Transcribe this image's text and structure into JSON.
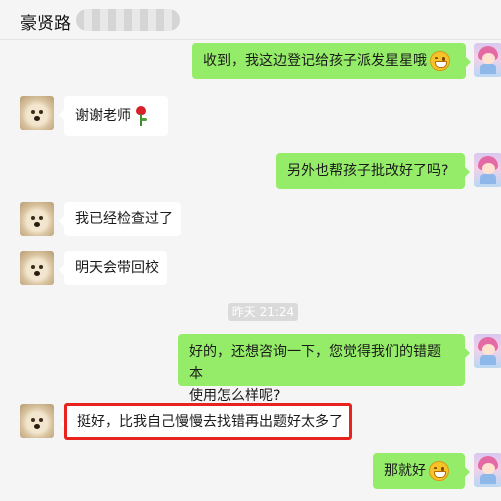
{
  "header": {
    "title": "豪贤路"
  },
  "timestamp": "昨天 21:24",
  "messages": [
    {
      "side": "right",
      "text": "收到，我这边登记给孩子派发星星哦",
      "emoji": "grin-emoji"
    },
    {
      "side": "left",
      "text": "谢谢老师",
      "emoji": "rose-emoji"
    },
    {
      "side": "right",
      "text": "另外也帮孩子批改好了吗?"
    },
    {
      "side": "left",
      "text": "我已经检查过了"
    },
    {
      "side": "left",
      "text": "明天会带回校"
    },
    {
      "side": "right",
      "line1": "好的，还想咨询一下，您觉得我们的错题本",
      "line2": "使用怎么样呢?"
    },
    {
      "side": "left",
      "text": "挺好，比我自己慢慢去找错再出题好太多了",
      "highlighted": true
    },
    {
      "side": "right",
      "text": "那就好",
      "emoji": "grin-emoji"
    }
  ],
  "colors": {
    "background": "#f5f5f5",
    "bubble_self": "#95ec69",
    "bubble_other": "#ffffff",
    "highlight": "#e8231e"
  }
}
